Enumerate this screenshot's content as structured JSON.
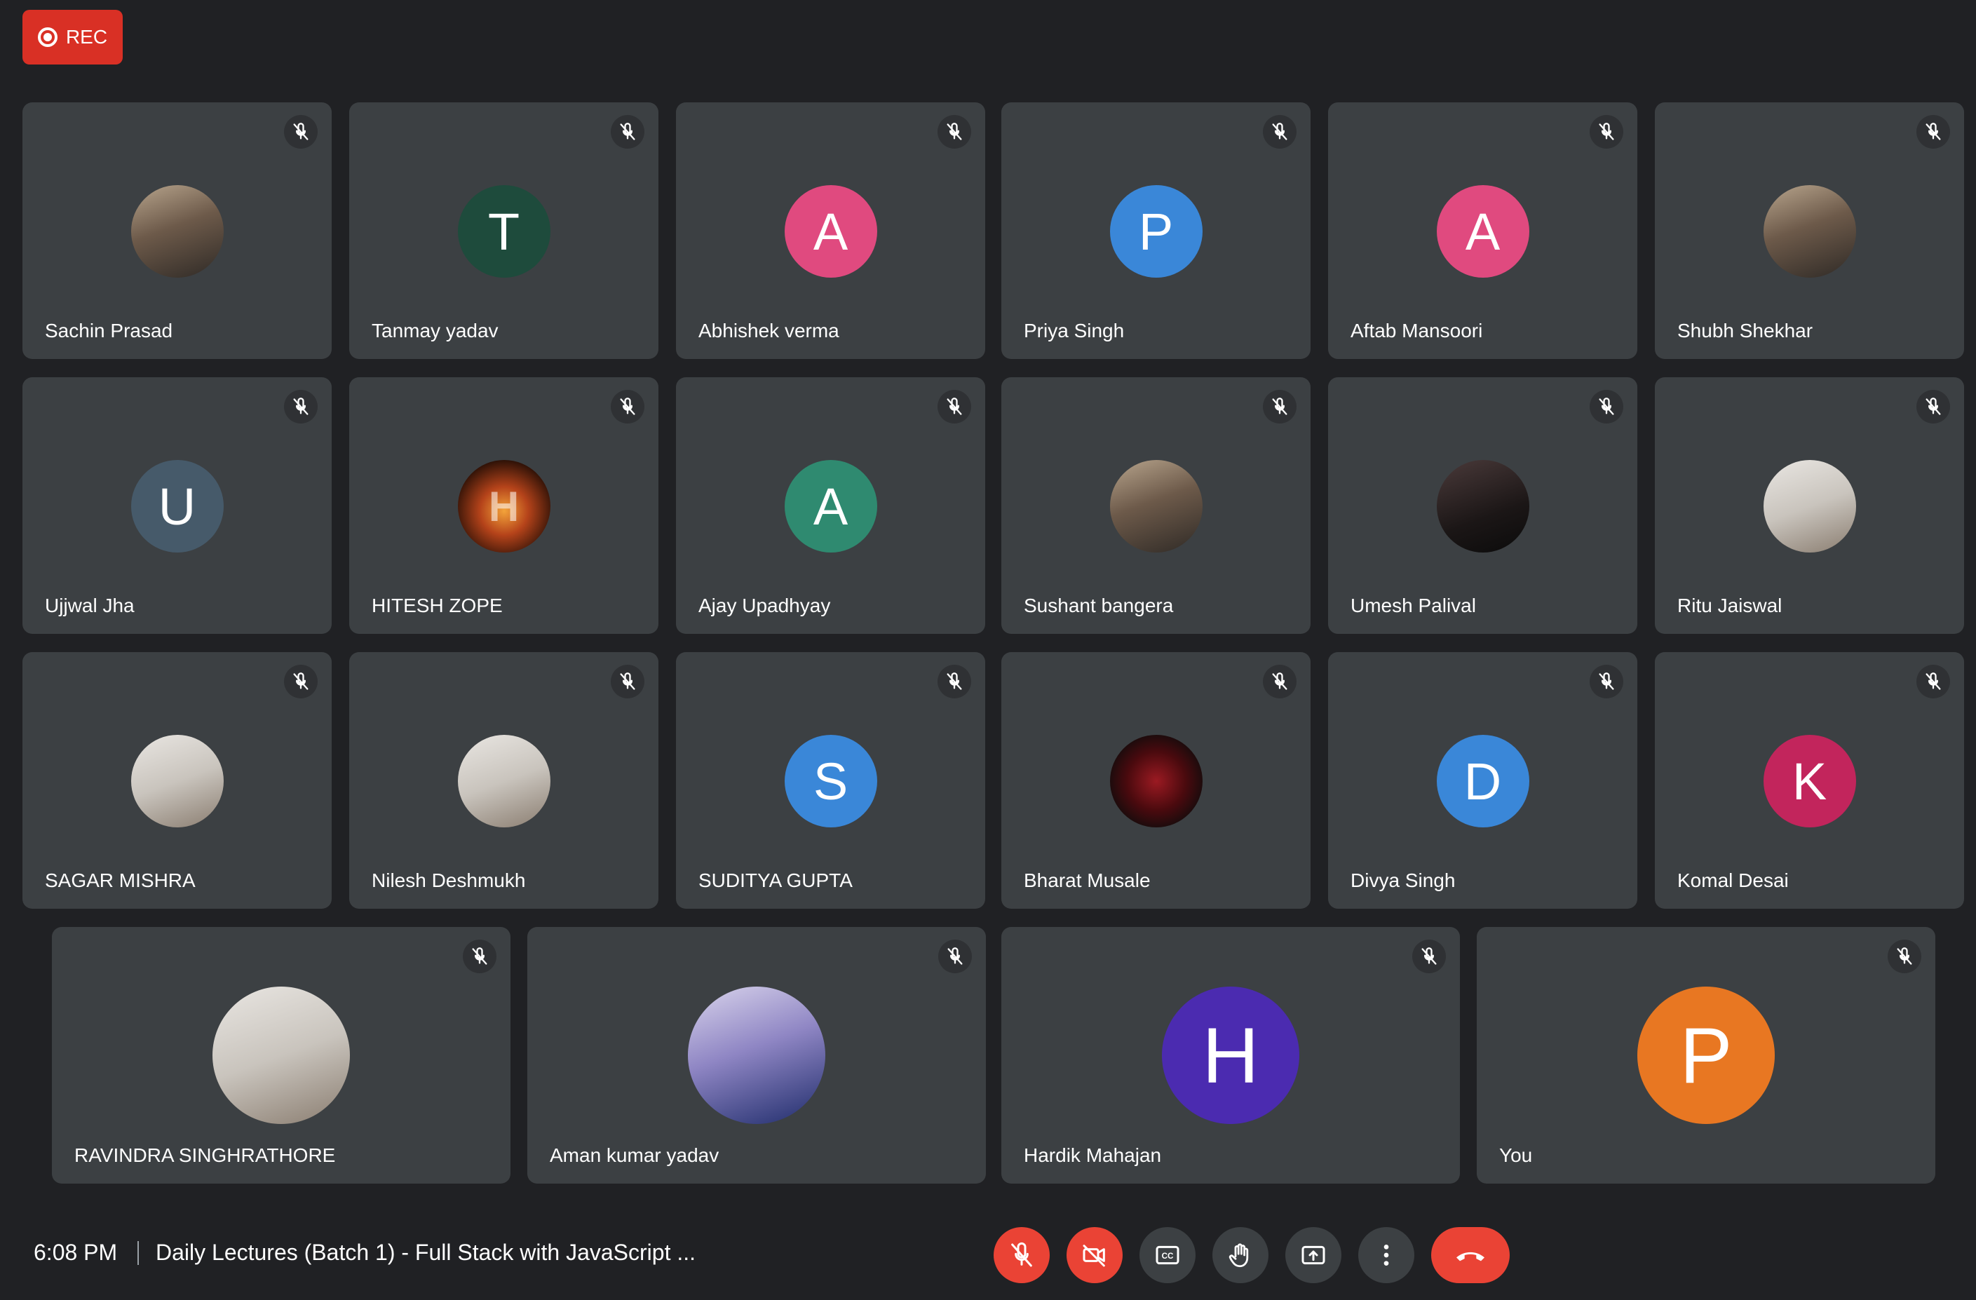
{
  "recording": {
    "label": "REC"
  },
  "participants": [
    {
      "name": "Sachin Prasad",
      "type": "photo",
      "style": "photo"
    },
    {
      "name": "Tanmay yadav",
      "type": "initial",
      "initial": "T",
      "color": "#1e4b3c"
    },
    {
      "name": "Abhishek verma",
      "type": "initial",
      "initial": "A",
      "color": "#e04a7f"
    },
    {
      "name": "Priya Singh",
      "type": "initial",
      "initial": "P",
      "color": "#3a87d8"
    },
    {
      "name": "Aftab Mansoori",
      "type": "initial",
      "initial": "A",
      "color": "#e04a7f"
    },
    {
      "name": "Shubh Shekhar",
      "type": "photo",
      "style": "photo"
    },
    {
      "name": "Ujjwal Jha",
      "type": "initial",
      "initial": "U",
      "color": "#465a6a"
    },
    {
      "name": "HITESH ZOPE",
      "type": "photo",
      "style": "photo-fire",
      "glyph": "H"
    },
    {
      "name": "Ajay Upadhyay",
      "type": "initial",
      "initial": "A",
      "color": "#2f8a70"
    },
    {
      "name": "Sushant bangera",
      "type": "photo",
      "style": "photo"
    },
    {
      "name": "Umesh Palival",
      "type": "photo",
      "style": "photo-dark"
    },
    {
      "name": "Ritu Jaiswal",
      "type": "photo",
      "style": "photo-light"
    },
    {
      "name": "SAGAR MISHRA",
      "type": "photo",
      "style": "photo-light"
    },
    {
      "name": "Nilesh Deshmukh",
      "type": "photo",
      "style": "photo-light"
    },
    {
      "name": "SUDITYA GUPTA",
      "type": "initial",
      "initial": "S",
      "color": "#3a87d8"
    },
    {
      "name": "Bharat Musale",
      "type": "photo",
      "style": "photo-rose"
    },
    {
      "name": "Divya Singh",
      "type": "initial",
      "initial": "D",
      "color": "#3a87d8"
    },
    {
      "name": "Komal Desai",
      "type": "initial",
      "initial": "K",
      "color": "#c2255c"
    },
    {
      "name": "RAVINDRA SINGHRATHORE",
      "type": "photo",
      "style": "photo-light"
    },
    {
      "name": "Aman kumar yadav",
      "type": "photo",
      "style": "photo-blue"
    },
    {
      "name": "Hardik Mahajan",
      "type": "initial",
      "initial": "H",
      "color": "#4b2bb0"
    },
    {
      "name": "You",
      "type": "initial",
      "initial": "P",
      "color": "#e87722"
    }
  ],
  "footer": {
    "time": "6:08 PM",
    "meeting_title": "Daily Lectures (Batch 1) - Full Stack with JavaScript ..."
  },
  "controls": [
    {
      "name": "mic-toggle-button",
      "icon": "mic-off-icon",
      "state": "off"
    },
    {
      "name": "camera-toggle-button",
      "icon": "camera-off-icon",
      "state": "off"
    },
    {
      "name": "captions-button",
      "icon": "captions-icon"
    },
    {
      "name": "raise-hand-button",
      "icon": "hand-icon"
    },
    {
      "name": "present-button",
      "icon": "present-icon"
    },
    {
      "name": "more-options-button",
      "icon": "more-vert-icon"
    },
    {
      "name": "leave-call-button",
      "icon": "call-end-icon"
    }
  ],
  "colors": {
    "background": "#202124",
    "tile": "#3c4043",
    "alert_red": "#ea4335",
    "rec_red": "#d93025"
  }
}
